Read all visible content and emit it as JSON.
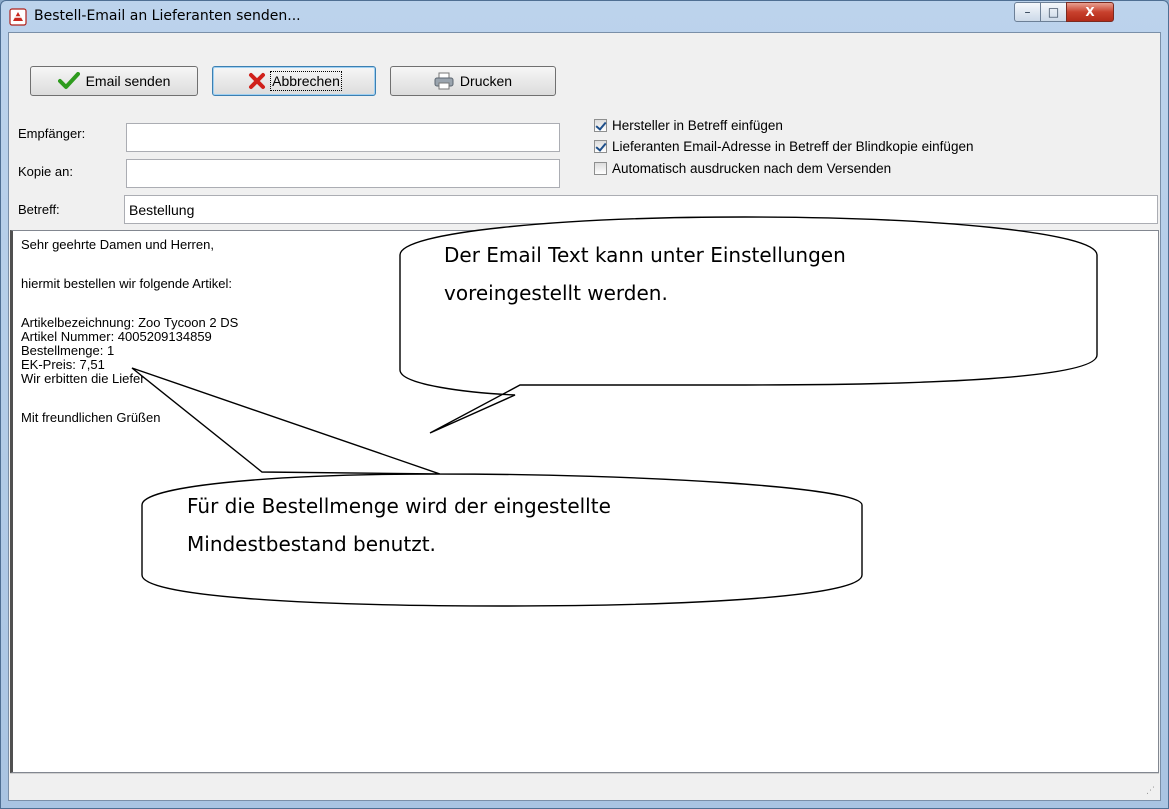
{
  "window": {
    "title": "Bestell-Email an Lieferanten senden...",
    "controls": {
      "minimize": "–",
      "maximize": "□",
      "close": "X"
    }
  },
  "toolbar": {
    "send_label": "Email senden",
    "cancel_label": "Abbrechen",
    "print_label": "Drucken"
  },
  "form": {
    "recipient_label": "Empfänger:",
    "recipient_value": "",
    "copy_label": "Kopie an:",
    "copy_value": "",
    "subject_label": "Betreff:",
    "subject_value": "Bestellung"
  },
  "options": [
    {
      "label": "Hersteller in Betreff einfügen",
      "checked": true
    },
    {
      "label": "Lieferanten Email-Adresse in Betreff der Blindkopie einfügen",
      "checked": true
    },
    {
      "label": "Automatisch ausdrucken nach dem Versenden",
      "checked": false
    }
  ],
  "email_body": {
    "greeting": "Sehr geehrte Damen und Herren,",
    "intro": "hiermit bestellen wir folgende Artikel:",
    "article_name": "Artikelbezeichnung: Zoo Tycoon 2 DS",
    "article_number": "Artikel Nummer: 4005209134859",
    "quantity": "Bestellmenge: 1",
    "price": "EK-Preis: 7,51",
    "delivery": "Wir erbitten die Liefer",
    "closing": "Mit freundlichen Grüßen"
  },
  "callouts": {
    "email_text_line1": "Der Email Text kann unter Einstellungen",
    "email_text_line2": "voreingestellt werden.",
    "quantity_line1": "Für die Bestellmenge wird der eingestellte",
    "quantity_line2": "Mindestbestand benutzt."
  },
  "colors": {
    "accent_blue": "#3c7fb1",
    "close_red": "#c8412d",
    "check_green": "#2e9b1e",
    "cancel_red": "#d0201a"
  }
}
